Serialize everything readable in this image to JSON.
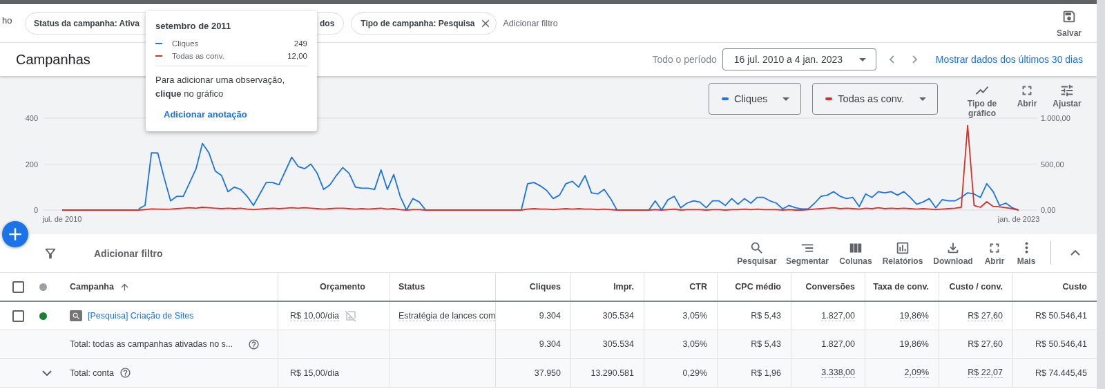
{
  "top_bar": {
    "cut_text": "ho",
    "filters": [
      {
        "label": "Status da campanha: Ativa"
      },
      {
        "label": "dos"
      },
      {
        "label": "Tipo de campanha: Pesquisa",
        "removable": true
      }
    ],
    "add_filter": "Adicionar filtro",
    "save_button": "Salvar"
  },
  "header": {
    "title": "Campanhas",
    "period_label": "Todo o período",
    "date_range": "16 jul. 2010 a 4 jan. 2023",
    "last_30_link": "Mostrar dados dos últimos 30 dias"
  },
  "chart": {
    "tools": [
      {
        "kind": "chart-type",
        "label": "Tipo de gráfico"
      },
      {
        "kind": "expand",
        "label": "Abrir"
      },
      {
        "kind": "adjust",
        "label": "Ajustar"
      }
    ],
    "chart_data": {
      "type": "line",
      "categories": [
        "jul. de 2010",
        null,
        null,
        null,
        null,
        null,
        null,
        null,
        null,
        null,
        null,
        null,
        null,
        null,
        null,
        null,
        null,
        null,
        null,
        null,
        null,
        null,
        null,
        null,
        null,
        null,
        null,
        null,
        null,
        null,
        null,
        null,
        null,
        null,
        null,
        null,
        null,
        null,
        null,
        null,
        null,
        null,
        null,
        null,
        null,
        null,
        null,
        null,
        null,
        null,
        null,
        null,
        null,
        null,
        null,
        null,
        null,
        null,
        null,
        null,
        null,
        null,
        null,
        null,
        null,
        null,
        null,
        null,
        null,
        null,
        null,
        null,
        null,
        null,
        null,
        null,
        null,
        null,
        null,
        null,
        null,
        null,
        null,
        null,
        null,
        null,
        null,
        null,
        null,
        null,
        null,
        null,
        null,
        null,
        null,
        null,
        null,
        null,
        null,
        null,
        null,
        null,
        null,
        null,
        null,
        null,
        null,
        null,
        null,
        null,
        null,
        null,
        null,
        null,
        null,
        null,
        null,
        null,
        null,
        null,
        null,
        null,
        null,
        null,
        null,
        null,
        null,
        null,
        null,
        null,
        null,
        null,
        null,
        null,
        null,
        null,
        null,
        null,
        null,
        null,
        null,
        null,
        null,
        null,
        null,
        null,
        null,
        null,
        null,
        null,
        "jan. de 2023"
      ],
      "ylim": [
        0,
        400
      ],
      "y2lim": [
        0,
        1000
      ],
      "yticks": [
        0,
        200,
        400
      ],
      "y2ticks": [
        {
          "value": 0,
          "label": "0,00"
        },
        {
          "value": 500,
          "label": "500,00"
        },
        {
          "value": 1000,
          "label": "1.000,00"
        }
      ],
      "series": [
        {
          "name": "Cliques",
          "color": "#1a73e8",
          "values": [
            null,
            null,
            null,
            null,
            null,
            null,
            null,
            null,
            null,
            null,
            null,
            null,
            5,
            20,
            249,
            248,
            140,
            40,
            60,
            60,
            120,
            180,
            290,
            250,
            170,
            150,
            80,
            100,
            90,
            60,
            20,
            70,
            120,
            120,
            110,
            170,
            230,
            190,
            180,
            200,
            160,
            90,
            110,
            150,
            185,
            160,
            100,
            95,
            95,
            90,
            175,
            90,
            155,
            60,
            0,
            50,
            35,
            0,
            0,
            0,
            0,
            0,
            0,
            0,
            0,
            0,
            0,
            0,
            0,
            0,
            0,
            0,
            0,
            115,
            120,
            105,
            85,
            50,
            65,
            115,
            125,
            100,
            150,
            75,
            70,
            90,
            50,
            0,
            0,
            0,
            0,
            0,
            0,
            40,
            0,
            45,
            60,
            10,
            30,
            40,
            35,
            10,
            40,
            40,
            20,
            50,
            25,
            50,
            30,
            55,
            55,
            40,
            30,
            5,
            20,
            10,
            5,
            5,
            30,
            60,
            65,
            80,
            60,
            50,
            55,
            15,
            70,
            55,
            80,
            75,
            80,
            65,
            80,
            55,
            25,
            35,
            50,
            10,
            45,
            40,
            40,
            55,
            75,
            70,
            55,
            115,
            80,
            20,
            30,
            10,
            0
          ]
        },
        {
          "name": "Todas as conv.",
          "color": "#d93025",
          "axis": "y2",
          "values": [
            0,
            0,
            0,
            0,
            0,
            0,
            0,
            0,
            0,
            0,
            0,
            0,
            0,
            5,
            12,
            10,
            8,
            10,
            15,
            20,
            25,
            20,
            30,
            25,
            20,
            15,
            20,
            15,
            20,
            10,
            5,
            10,
            15,
            20,
            15,
            20,
            25,
            20,
            25,
            20,
            15,
            10,
            15,
            20,
            20,
            15,
            10,
            15,
            10,
            15,
            20,
            10,
            15,
            5,
            0,
            5,
            5,
            0,
            0,
            0,
            0,
            0,
            0,
            0,
            0,
            0,
            0,
            0,
            0,
            0,
            0,
            0,
            0,
            10,
            15,
            10,
            10,
            5,
            10,
            15,
            10,
            15,
            10,
            10,
            5,
            10,
            5,
            0,
            0,
            0,
            0,
            0,
            0,
            5,
            0,
            5,
            10,
            0,
            5,
            5,
            5,
            0,
            5,
            5,
            0,
            5,
            5,
            10,
            5,
            10,
            5,
            5,
            5,
            0,
            5,
            0,
            0,
            5,
            10,
            15,
            20,
            25,
            15,
            20,
            15,
            10,
            20,
            15,
            25,
            15,
            20,
            15,
            20,
            15,
            10,
            15,
            10,
            5,
            10,
            15,
            20,
            30,
            920,
            50,
            30,
            90,
            40,
            35,
            25,
            15,
            0
          ]
        }
      ]
    }
  },
  "tooltip": {
    "title": "setembro de 2011",
    "series": [
      {
        "label": "Cliques",
        "value": "249",
        "color": "#1a73e8"
      },
      {
        "label": "Todas as conv.",
        "value": "12,00",
        "color": "#d93025"
      }
    ],
    "hint": "Para adicionar uma observação, **clique** no gráfico",
    "action": "Adicionar anotação"
  },
  "table_toolbar": {
    "add_filter": "Adicionar filtro",
    "tools": [
      {
        "kind": "search",
        "label": "Pesquisar"
      },
      {
        "kind": "segment",
        "label": "Segmentar"
      },
      {
        "kind": "columns",
        "label": "Colunas"
      },
      {
        "kind": "reports",
        "label": "Relatórios"
      },
      {
        "kind": "download",
        "label": "Download"
      },
      {
        "kind": "expand",
        "label": "Abrir"
      },
      {
        "kind": "more",
        "label": "Mais"
      }
    ]
  },
  "table": {
    "header_checked": false,
    "columns": [
      {
        "label": "Campanha",
        "sorted": true
      },
      {
        "label": "Orçamento",
        "sorted": false
      },
      {
        "label": "Status",
        "sorted": false
      },
      {
        "label": "Cliques",
        "sorted": false
      },
      {
        "label": "Impr.",
        "sorted": false
      },
      {
        "label": "CTR",
        "sorted": false
      },
      {
        "label": "CPC médio",
        "sorted": false
      },
      {
        "label": "Conversões",
        "sorted": false
      },
      {
        "label": "Taxa de conv.",
        "sorted": false
      },
      {
        "label": "Custo / conv.",
        "sorted": false
      },
      {
        "label": "Custo",
        "sorted": false
      }
    ],
    "rows": [
      {
        "kind": "campaign",
        "checked": false,
        "color": "#188038",
        "cells": [
          "[Pesquisa] Criação de Sites",
          "R$ 10,00/dia",
          "Estratégia de lances com",
          "9.304",
          "305.534",
          "3,05%",
          "R$ 5,43",
          "1.827,00",
          "19,86%",
          "R$ 27,60",
          "R$ 50.546,41"
        ]
      },
      {
        "kind": "subtotal",
        "cells": [
          "Total: todas as campanhas ativadas no s...",
          "",
          "",
          "9.304",
          "305.534",
          "3,05%",
          "R$ 5,43",
          "1.827,00",
          "19,86%",
          "R$ 27,60",
          "R$ 50.546,41"
        ]
      },
      {
        "kind": "account",
        "expanded": false,
        "cells": [
          "Total: conta",
          "R$ 15,00/dia",
          "",
          "37.950",
          "13.290.581",
          "0,29%",
          "R$ 1,96",
          "3.338,00",
          "2,09%",
          "R$ 22,07",
          "R$ 74.445,45"
        ]
      }
    ]
  }
}
